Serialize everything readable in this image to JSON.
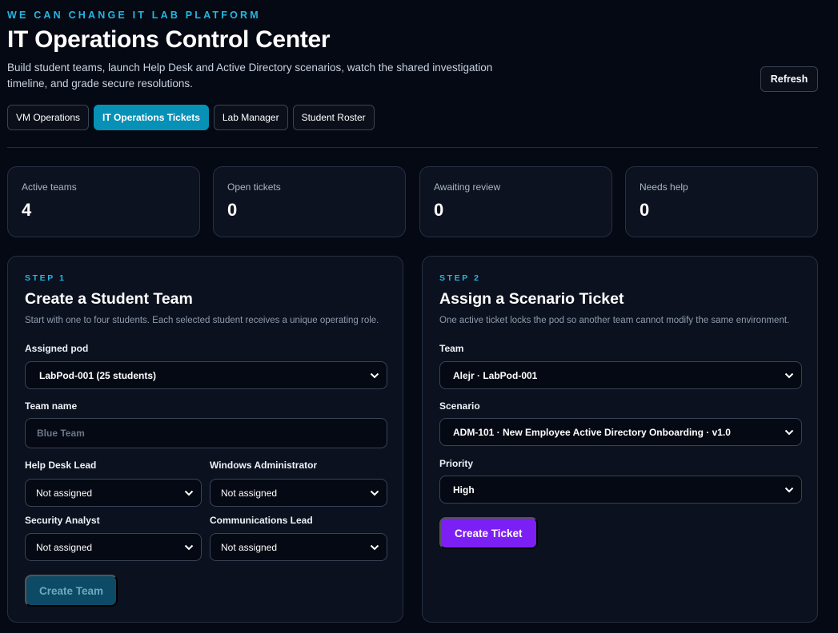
{
  "header": {
    "brand": "WE CAN CHANGE IT LAB PLATFORM",
    "title": "IT Operations Control Center",
    "description": "Build student teams, launch Help Desk and Active Directory scenarios, watch the shared investigation timeline, and grade secure resolutions.",
    "refresh_label": "Refresh"
  },
  "tabs": [
    {
      "label": "VM Operations",
      "active": false
    },
    {
      "label": "IT Operations Tickets",
      "active": true
    },
    {
      "label": "Lab Manager",
      "active": false
    },
    {
      "label": "Student Roster",
      "active": false
    }
  ],
  "stats": [
    {
      "label": "Active teams",
      "value": "4"
    },
    {
      "label": "Open tickets",
      "value": "0"
    },
    {
      "label": "Awaiting review",
      "value": "0"
    },
    {
      "label": "Needs help",
      "value": "0"
    }
  ],
  "team_panel": {
    "step": "STEP 1",
    "title": "Create a Student Team",
    "description": "Start with one to four students. Each selected student receives a unique operating role.",
    "pod_label": "Assigned pod",
    "pod_value": "LabPod-001 (25 students)",
    "team_name_label": "Team name",
    "team_name_placeholder": "Blue Team",
    "roles": [
      {
        "label": "Help Desk Lead",
        "value": "Not assigned"
      },
      {
        "label": "Windows Administrator",
        "value": "Not assigned"
      },
      {
        "label": "Security Analyst",
        "value": "Not assigned"
      },
      {
        "label": "Communications Lead",
        "value": "Not assigned"
      }
    ],
    "create_label": "Create Team"
  },
  "ticket_panel": {
    "step": "STEP 2",
    "title": "Assign a Scenario Ticket",
    "description": "One active ticket locks the pod so another team cannot modify the same environment.",
    "team_label": "Team",
    "team_value": "Alejr · LabPod-001",
    "scenario_label": "Scenario",
    "scenario_value": "ADM-101 · New Employee Active Directory Onboarding · v1.0",
    "priority_label": "Priority",
    "priority_value": "High",
    "create_label": "Create Ticket"
  },
  "colors": {
    "accent": "#23b7e3",
    "active_tab": "#0791b7",
    "primary_button": "#7c1ff5",
    "disabled_button": "#0c4a66",
    "background": "#050913"
  },
  "icons": {
    "select": "chevron-down-icon"
  }
}
